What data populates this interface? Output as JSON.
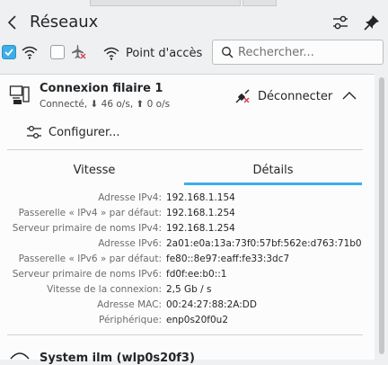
{
  "header": {
    "title": "Réseaux"
  },
  "toolbar": {
    "wifi_enabled": true,
    "airplane_enabled": false,
    "hotspot_label": "Point d'accès",
    "search_placeholder": "Rechercher..."
  },
  "connection": {
    "name": "Connexion filaire 1",
    "status": "Connecté, ⬇ 46 o/s, ⬆ 0 o/s",
    "disconnect_label": "Déconnecter",
    "configure_label": "Configurer..."
  },
  "tabs": [
    {
      "label": "Vitesse",
      "active": false
    },
    {
      "label": "Détails",
      "active": true
    }
  ],
  "details": [
    {
      "label": "Adresse IPv4:",
      "value": "192.168.1.154"
    },
    {
      "label": "Passerelle « IPv4 » par défaut:",
      "value": "192.168.1.254"
    },
    {
      "label": "Serveur primaire de noms IPv4:",
      "value": "192.168.1.254"
    },
    {
      "label": "Adresse IPv6:",
      "value": "2a01:e0a:13a:73f0:57bf:562e:d763:71b0"
    },
    {
      "label": "Passerelle « IPv6 » par défaut:",
      "value": "fe80::8e97:eaff:fe33:3dc7"
    },
    {
      "label": "Serveur primaire de noms IPv6:",
      "value": "fd0f:ee:b0::1"
    },
    {
      "label": "Vitesse de la connexion:",
      "value": "2,5 Gb / s"
    },
    {
      "label": "Adresse MAC:",
      "value": "00:24:27:88:2A:DD"
    },
    {
      "label": "Périphérique:",
      "value": "enp0s20f0u2"
    }
  ],
  "next_network": {
    "name": "System ilm (wlp0s20f3)"
  },
  "colors": {
    "accent": "#3daee9",
    "background": "#eff0f1",
    "panel": "#fcfcfc",
    "text": "#232629",
    "label": "#6a6d70",
    "error_red": "#da4453"
  }
}
